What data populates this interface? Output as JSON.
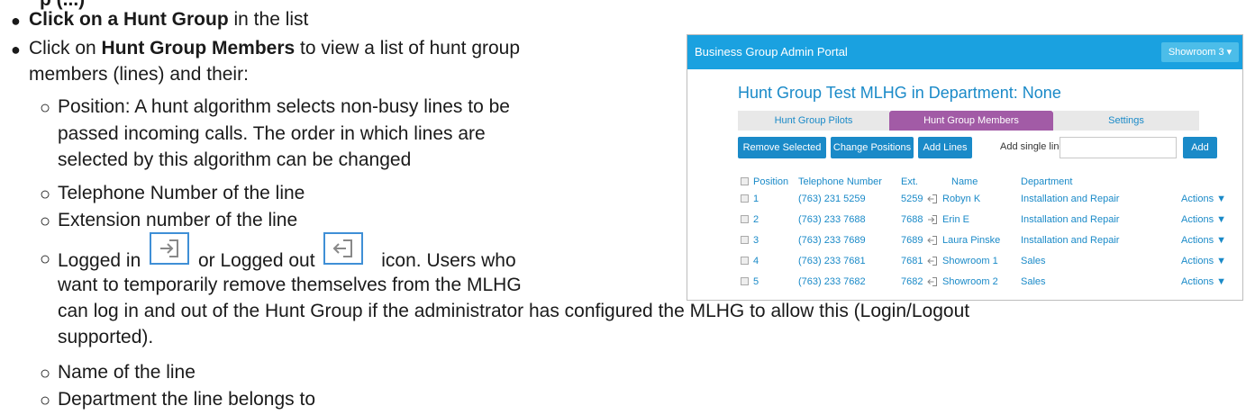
{
  "doc": {
    "line0_bold": "Click on a Hunt Group",
    "line0_rest": " in the list",
    "line1_pre": "Click on ",
    "line1_bold": "Hunt Group Members",
    "line1_rest": " to view a list of hunt group",
    "line2": "members (lines) and their:",
    "sub_position_a": "Position: A hunt algorithm selects non-busy lines to be",
    "sub_position_b": "passed incoming calls. The order in which lines are",
    "sub_position_c": "selected by this algorithm can be changed",
    "sub_tel": "Telephone Number of the line",
    "sub_ext": "Extension number of the line",
    "sub_log_a": "Logged in",
    "sub_log_b": "or Logged out",
    "sub_log_c": "icon. Users who",
    "sub_log_d": "want to temporarily remove themselves from the MLHG",
    "cont_a": "can log in and out of the Hunt Group if the administrator has configured the MLHG to allow this (Login/Logout",
    "cont_b": "supported).",
    "sub_name": "Name of the line",
    "sub_dept": "Department the line belongs to",
    "top_cut": "p (...)"
  },
  "portal": {
    "title": "Business Group Admin Portal",
    "showroom": "Showroom 3 ▾",
    "heading": "Hunt Group Test MLHG in Department: None",
    "tabs": [
      "Hunt Group Pilots",
      "Hunt Group Members",
      "Settings"
    ],
    "buttons": {
      "remove": "Remove Selected",
      "change": "Change Positions",
      "add_lines": "Add Lines",
      "add_single_label": "Add single line:",
      "add": "Add"
    },
    "columns": [
      "Position",
      "Telephone Number",
      "Ext.",
      "Name",
      "Department"
    ],
    "rows": [
      {
        "pos": "1",
        "tel": "(763) 231 5259",
        "ext": "5259",
        "login": "out",
        "name": "Robyn K",
        "dept": "Installation and Repair",
        "act": "Actions ▼"
      },
      {
        "pos": "2",
        "tel": "(763) 233 7688",
        "ext": "7688",
        "login": "in",
        "name": "Erin E",
        "dept": "Installation and Repair",
        "act": "Actions ▼"
      },
      {
        "pos": "3",
        "tel": "(763) 233 7689",
        "ext": "7689",
        "login": "out",
        "name": "Laura Pinske",
        "dept": "Installation and Repair",
        "act": "Actions ▼"
      },
      {
        "pos": "4",
        "tel": "(763) 233 7681",
        "ext": "7681",
        "login": "out",
        "name": "Showroom 1",
        "dept": "Sales",
        "act": "Actions ▼"
      },
      {
        "pos": "5",
        "tel": "(763) 233 7682",
        "ext": "7682",
        "login": "out",
        "name": "Showroom 2",
        "dept": "Sales",
        "act": "Actions ▼"
      }
    ]
  },
  "colors": {
    "accent": "#1a8ac8",
    "header": "#1aa1e0",
    "active_tab": "#a25ba6"
  },
  "icons": {
    "logged_in": "login-icon",
    "logged_out": "logout-icon"
  }
}
